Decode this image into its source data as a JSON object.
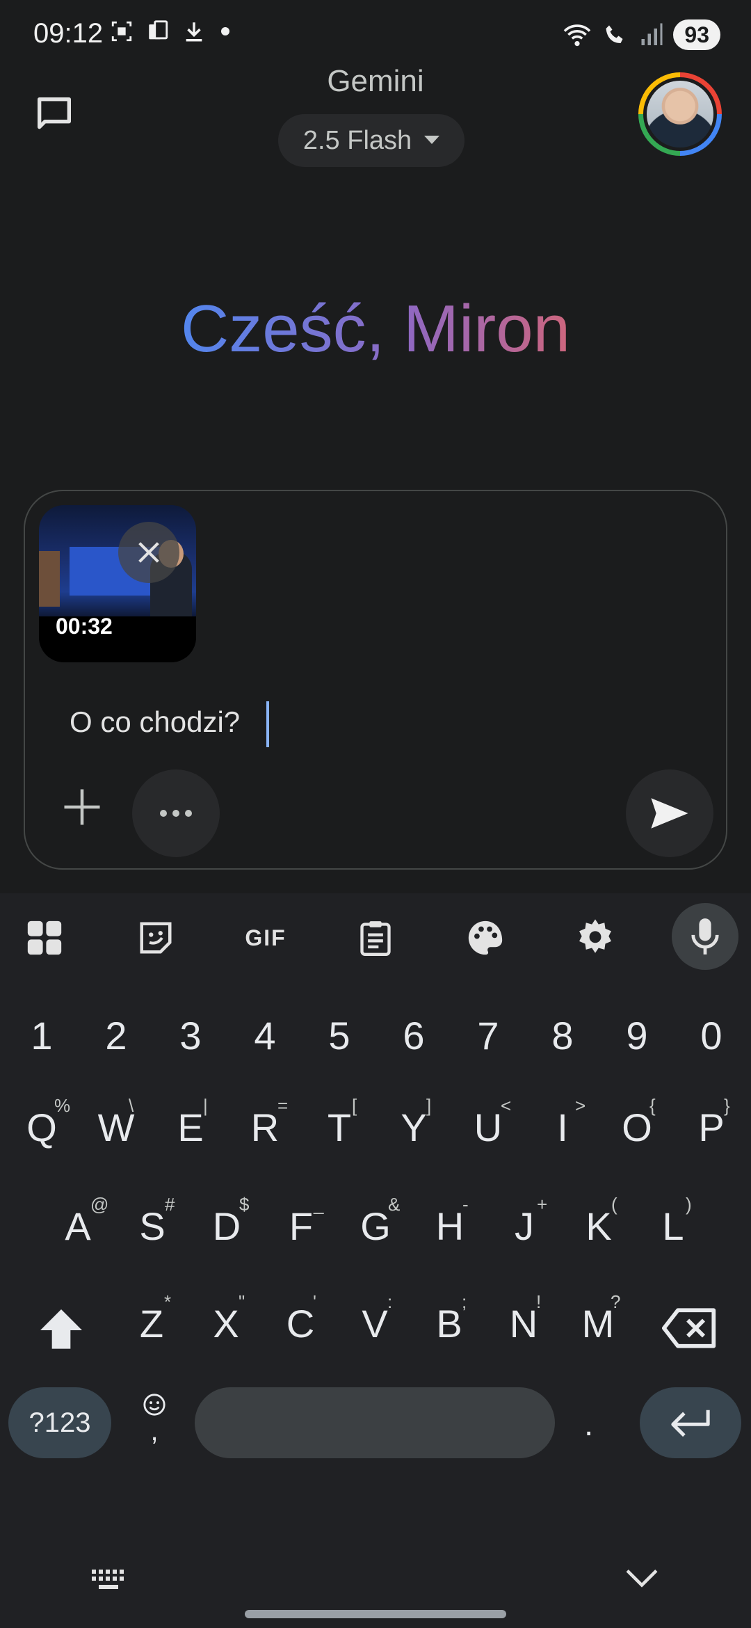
{
  "status_bar": {
    "time": "09:12",
    "battery": "93",
    "icons_left": [
      "screenshot-icon",
      "phone-storage-icon",
      "download-icon",
      "dot-icon"
    ],
    "icons_right": [
      "wifi-icon",
      "wifi-call-icon",
      "signal-icon"
    ]
  },
  "header": {
    "title": "Gemini",
    "model_label": "2.5 Flash"
  },
  "greeting": "Cześć, Miron",
  "attachment": {
    "duration": "00:32"
  },
  "prompt": {
    "text": "O co chodzi?"
  },
  "keyboard": {
    "toolbar": {
      "gif_label": "GIF"
    },
    "number_row": [
      "1",
      "2",
      "3",
      "4",
      "5",
      "6",
      "7",
      "8",
      "9",
      "0"
    ],
    "row1": [
      {
        "k": "Q",
        "s": "%"
      },
      {
        "k": "W",
        "s": "\\"
      },
      {
        "k": "E",
        "s": "|"
      },
      {
        "k": "R",
        "s": "="
      },
      {
        "k": "T",
        "s": "["
      },
      {
        "k": "Y",
        "s": "]"
      },
      {
        "k": "U",
        "s": "<"
      },
      {
        "k": "I",
        "s": ">"
      },
      {
        "k": "O",
        "s": "{"
      },
      {
        "k": "P",
        "s": "}"
      }
    ],
    "row2": [
      {
        "k": "A",
        "s": "@"
      },
      {
        "k": "S",
        "s": "#"
      },
      {
        "k": "D",
        "s": "$"
      },
      {
        "k": "F",
        "s": "_"
      },
      {
        "k": "G",
        "s": "&"
      },
      {
        "k": "H",
        "s": "-"
      },
      {
        "k": "J",
        "s": "+"
      },
      {
        "k": "K",
        "s": "("
      },
      {
        "k": "L",
        "s": ")"
      }
    ],
    "row3": [
      {
        "k": "Z",
        "s": "*"
      },
      {
        "k": "X",
        "s": "\""
      },
      {
        "k": "C",
        "s": "'"
      },
      {
        "k": "V",
        "s": ":"
      },
      {
        "k": "B",
        "s": ";"
      },
      {
        "k": "N",
        "s": "!"
      },
      {
        "k": "M",
        "s": "?"
      }
    ],
    "num_switch_label": "?123",
    "comma_label": ",",
    "period_label": "."
  },
  "colors": {
    "background": "#1b1c1d",
    "keyboard_bg": "#202124",
    "accent": "#8ab4f8"
  }
}
